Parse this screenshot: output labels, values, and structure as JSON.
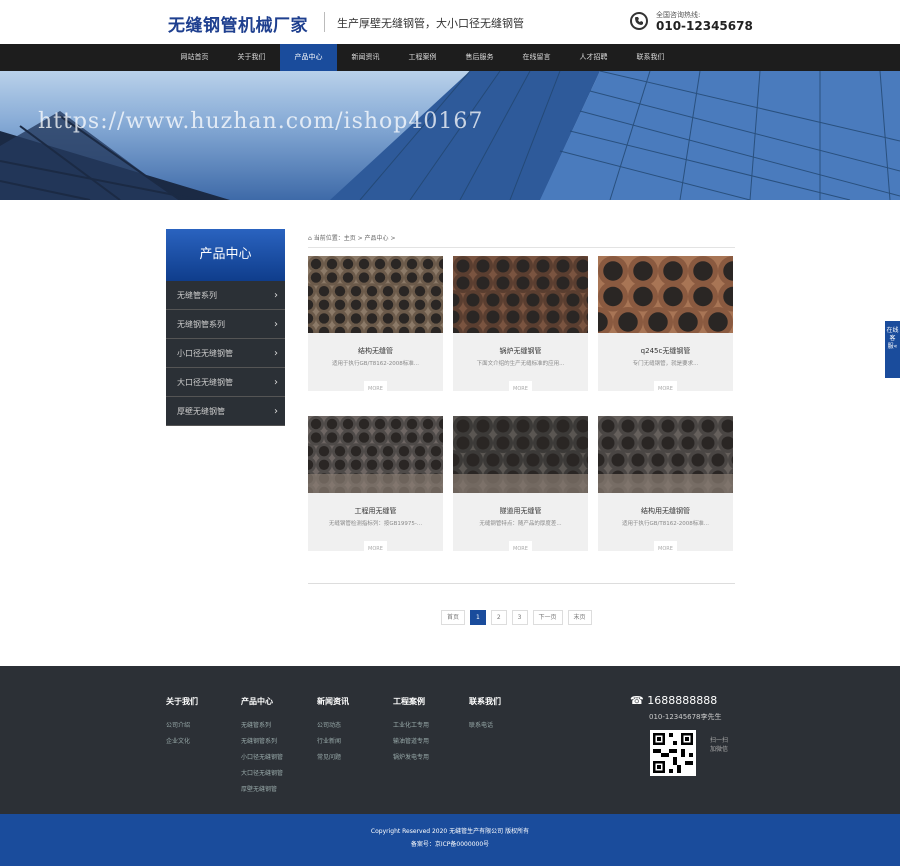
{
  "header": {
    "logo_title": "无缝钢管机械厂家",
    "slogan": "生产厚壁无缝钢管，大小口径无缝钢管",
    "hotline_label": "全国咨询热线:",
    "hotline_number": "010-12345678"
  },
  "nav": {
    "items": [
      "网站首页",
      "关于我们",
      "产品中心",
      "新闻资讯",
      "工程案例",
      "售后服务",
      "在线留言",
      "人才招聘",
      "联系我们"
    ],
    "active_index": 2
  },
  "banner": {
    "watermark": "https://www.huzhan.com/ishop40167"
  },
  "sidebar": {
    "title": "产品中心",
    "items": [
      "无缝管系列",
      "无缝钢管系列",
      "小口径无缝钢管",
      "大口径无缝钢管",
      "厚壁无缝钢管"
    ]
  },
  "breadcrumb": {
    "text": "当前位置：主页 > 产品中心 >"
  },
  "products": [
    {
      "name": "结构无缝管",
      "desc": "适用于执行GB/T8162-2008标准...",
      "more": "MORE"
    },
    {
      "name": "锅炉无缝钢管",
      "desc": "下面文介绍的生产无缝标准的应用...",
      "more": "MORE"
    },
    {
      "name": "q245c无缝钢管",
      "desc": "专门无缝钢管，就是要求...",
      "more": "MORE"
    },
    {
      "name": "工程用无缝管",
      "desc": "无缝钢管检测指标列：按GB19975-...",
      "more": "MORE"
    },
    {
      "name": "隧道用无缝管",
      "desc": "无缝钢管特点：随产品的厚度差...",
      "more": "MORE"
    },
    {
      "name": "结构用无缝钢管",
      "desc": "适用于执行GB/T8162-2008标准...",
      "more": "MORE"
    }
  ],
  "pager": {
    "first": "首页",
    "pages": [
      "1",
      "2",
      "3"
    ],
    "current": "1",
    "next": "下一页",
    "last": "末页"
  },
  "footer": {
    "columns": [
      {
        "title": "关于我们",
        "links": [
          "公司介绍",
          "企业文化"
        ]
      },
      {
        "title": "产品中心",
        "links": [
          "无缝管系列",
          "无缝钢管系列",
          "小口径无缝钢管",
          "大口径无缝钢管",
          "厚壁无缝钢管"
        ]
      },
      {
        "title": "新闻资讯",
        "links": [
          "公司动态",
          "行业新闻",
          "常见问题"
        ]
      },
      {
        "title": "工程案例",
        "links": [
          "工业化工专用",
          "输油管道专用",
          "锅炉发电专用"
        ]
      },
      {
        "title": "联系我们",
        "links": [
          "联系电话"
        ]
      }
    ],
    "phone": "1688888888",
    "phone2": "010-12345678李先生",
    "scan_text": "扫一扫 加微信"
  },
  "copyright": {
    "line1": "Copyright Reserved 2020 无缝管生产有限公司 版权所有",
    "line2": "备案号：京ICP备0000000号"
  },
  "float_tab": {
    "label": "在线客服«"
  },
  "colors": {
    "primary": "#1a4c9c",
    "nav_bg": "#1d1d1d",
    "footer_bg": "#2c3036"
  }
}
